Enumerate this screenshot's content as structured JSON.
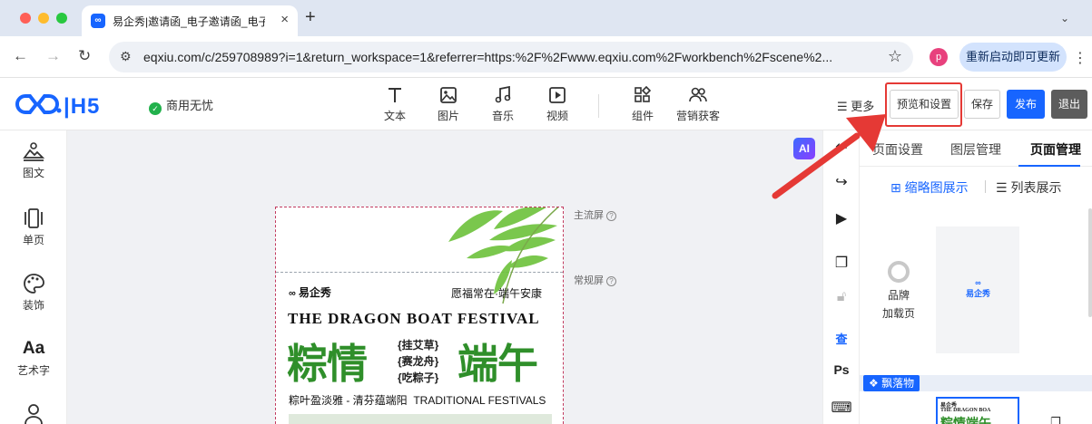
{
  "browser": {
    "tab_title": "易企秀|邀请函_电子邀请函_电子",
    "tab_favicon_text": "∞",
    "new_tab_icon": "plus-icon",
    "url": "eqxiu.com/c/259708989?i=1&return_workspace=1&referrer=https:%2F%2Fwww.eqxiu.com%2Fworkbench%2Fscene%2...",
    "profile_initial": "p",
    "update_label": "重新启动即可更新"
  },
  "header": {
    "logo_text": "H5",
    "commercial_label": "商用无忧",
    "tools": [
      {
        "icon": "text-icon",
        "label": "文本"
      },
      {
        "icon": "image-icon",
        "label": "图片"
      },
      {
        "icon": "music-icon",
        "label": "音乐"
      },
      {
        "icon": "video-icon",
        "label": "视频"
      },
      {
        "icon": "component-icon",
        "label": "组件"
      },
      {
        "icon": "marketing-icon",
        "label": "营销获客"
      }
    ],
    "more_label": "更多",
    "preview_label": "预览和设置",
    "save_label": "保存",
    "publish_label": "发布",
    "exit_label": "退出"
  },
  "sidebar": {
    "items": [
      {
        "icon": "image-text-icon",
        "label": "图文"
      },
      {
        "icon": "single-page-icon",
        "label": "单页"
      },
      {
        "icon": "palette-icon",
        "label": "装饰"
      },
      {
        "icon": "art-text-icon",
        "label": "艺术字"
      },
      {
        "icon": "user-icon",
        "label": ""
      }
    ]
  },
  "canvas": {
    "ai_label": "AI",
    "main_screen_label": "主流屏",
    "normal_screen_label": "常规屏",
    "help_glyph": "?",
    "poster": {
      "brand": "易企秀",
      "blessing": "愿福常在·端午安康",
      "english_title": "THE DRAGON BOAT FESTIVAL",
      "big_left": "粽情",
      "big_right": "端午",
      "tags": [
        "{挂艾草}",
        "{赛龙舟}",
        "{吃粽子}"
      ],
      "subtitle_cn": "粽叶盈淡雅 - 清芬蕴端阳",
      "subtitle_en": "TRADITIONAL FESTIVALS"
    }
  },
  "right_tools": [
    "undo-icon",
    "redo-icon",
    "play-icon",
    "copy-icon",
    "lock-icon",
    "check-icon",
    "ps-icon",
    "keyboard-icon"
  ],
  "right_tools_labels": {
    "ps": "Ps",
    "check": "查"
  },
  "panel": {
    "tabs": [
      "页面设置",
      "图层管理",
      "页面管理"
    ],
    "active_tab": "页面管理",
    "thumb_view_label": "缩略图展示",
    "list_view_label": "列表展示",
    "loading_label_line1": "品牌",
    "loading_label_line2": "加载页",
    "loading_logo": "易企秀",
    "float_label": "飘落物",
    "thumb_brand": "易企秀",
    "thumb_english": "THE DRAGON BOA",
    "thumb_big": "粽情端午"
  },
  "colors": {
    "accent": "#1765ff",
    "highlight": "#e53935",
    "poster_green": "#2f8f2a",
    "exit_button": "#5c5c5c"
  }
}
